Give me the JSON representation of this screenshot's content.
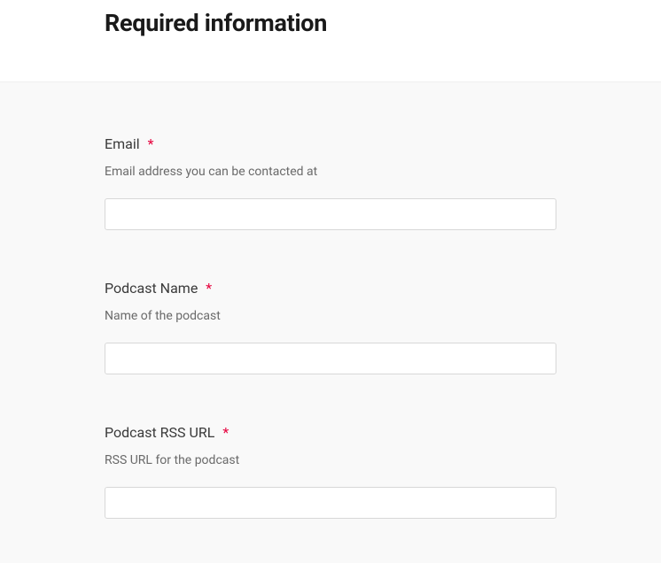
{
  "header": {
    "title": "Required information"
  },
  "form": {
    "fields": [
      {
        "label": "Email",
        "required_mark": "*",
        "description": "Email address you can be contacted at",
        "value": ""
      },
      {
        "label": "Podcast Name",
        "required_mark": "*",
        "description": "Name of the podcast",
        "value": ""
      },
      {
        "label": "Podcast RSS URL",
        "required_mark": "*",
        "description": "RSS URL for the podcast",
        "value": ""
      }
    ]
  }
}
